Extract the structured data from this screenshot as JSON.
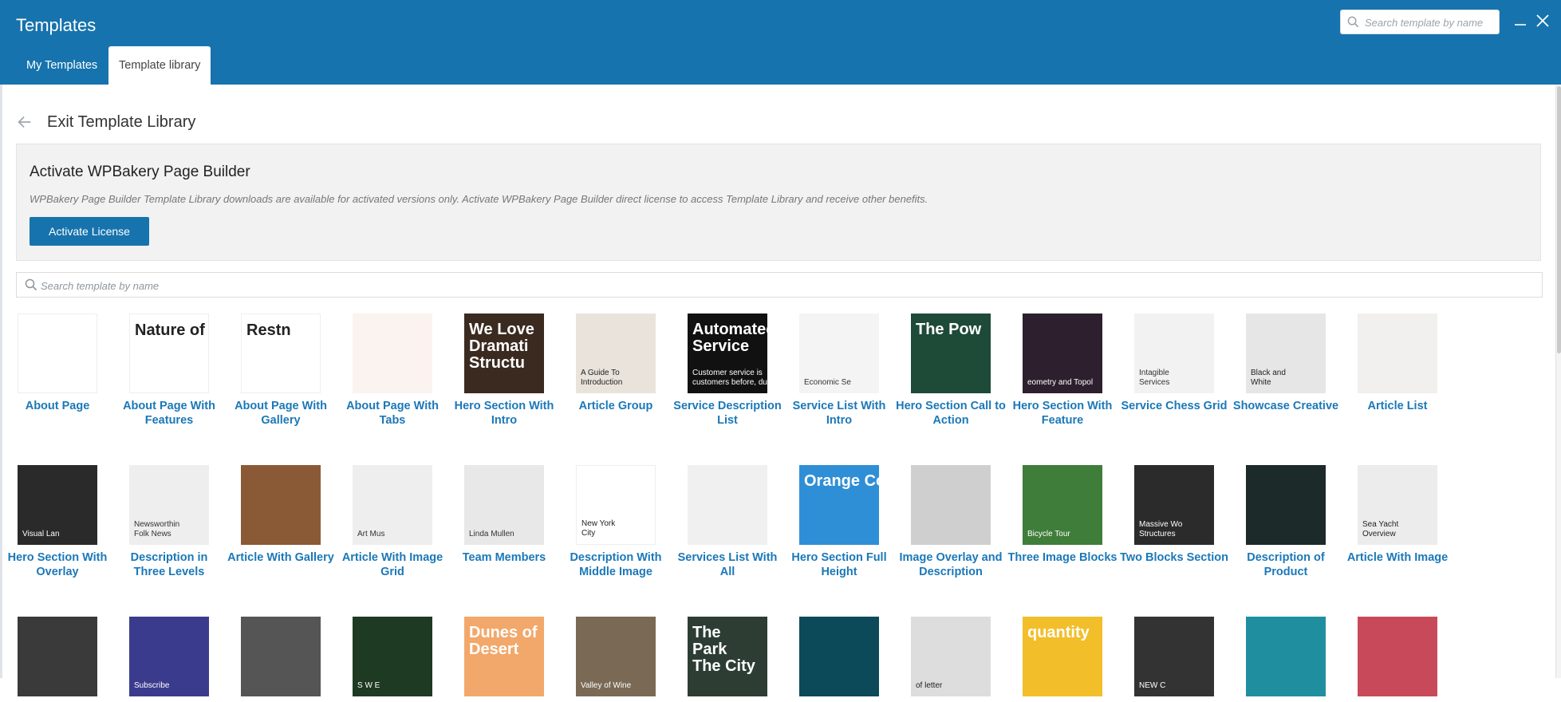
{
  "modal": {
    "title": "Templates"
  },
  "header_search": {
    "placeholder": "Search template by name"
  },
  "tabs": [
    {
      "label": "My Templates"
    },
    {
      "label": "Template library"
    }
  ],
  "back": {
    "label": "Exit Template Library"
  },
  "notice": {
    "title": "Activate WPBakery Page Builder",
    "text": "WPBakery Page Builder Template Library downloads are available for activated versions only. Activate WPBakery Page Builder direct license to access Template Library and receive other benefits.",
    "button_label": "Activate License"
  },
  "library_search": {
    "placeholder": "Search template by name"
  },
  "templates": [
    {
      "name": "About Page",
      "bg": "#ffffff",
      "fg": "#333333",
      "thumb_title": "",
      "thumb_sub": ""
    },
    {
      "name": "About Page With Features",
      "bg": "#ffffff",
      "fg": "#222222",
      "thumb_title": "Nature of De",
      "thumb_sub": ""
    },
    {
      "name": "About Page With Gallery",
      "bg": "#ffffff",
      "fg": "#222222",
      "thumb_title": "Restn",
      "thumb_sub": ""
    },
    {
      "name": "About Page With Tabs",
      "bg": "#fbf3ef",
      "fg": "#555555",
      "thumb_title": "",
      "thumb_sub": ""
    },
    {
      "name": "Hero Section With Intro",
      "bg": "#3a2a20",
      "fg": "#ffffff",
      "thumb_title": "We Love\nDramati\nStructu",
      "thumb_sub": ""
    },
    {
      "name": "Article Group",
      "bg": "#e9e3dc",
      "fg": "#222222",
      "thumb_title": "",
      "thumb_sub": "A Guide To\nIntroduction"
    },
    {
      "name": "Service Description List",
      "bg": "#111111",
      "fg": "#ffffff",
      "thumb_title": "Automated\nService",
      "thumb_sub": "Customer service is\ncustomers before, du"
    },
    {
      "name": "Service List With Intro",
      "bg": "#f4f4f4",
      "fg": "#333333",
      "thumb_title": "",
      "thumb_sub": "Economic Se"
    },
    {
      "name": "Hero Section Call to Action",
      "bg": "#1e4a38",
      "fg": "#ffffff",
      "thumb_title": "The Pow",
      "thumb_sub": ""
    },
    {
      "name": "Hero Section With Feature",
      "bg": "#2d1f2d",
      "fg": "#ffffff",
      "thumb_title": "",
      "thumb_sub": "eometry and Topol"
    },
    {
      "name": "Service Chess Grid",
      "bg": "#f2f2f2",
      "fg": "#333333",
      "thumb_title": "",
      "thumb_sub": "Intagible\nServices"
    },
    {
      "name": "Showcase Creative",
      "bg": "#e6e6e6",
      "fg": "#222222",
      "thumb_title": "",
      "thumb_sub": "Black and\nWhite"
    },
    {
      "name": "Article List",
      "bg": "#f2f0ee",
      "fg": "#555555",
      "thumb_title": "",
      "thumb_sub": ""
    },
    {
      "name": "Hero Section With Overlay",
      "bg": "#2a2a2a",
      "fg": "#ffffff",
      "thumb_title": "",
      "thumb_sub": "Visual Lan"
    },
    {
      "name": "Description in Three Levels",
      "bg": "#eeeeee",
      "fg": "#333333",
      "thumb_title": "",
      "thumb_sub": "Newsworthin\nFolk News"
    },
    {
      "name": "Article With Gallery",
      "bg": "#8a5a36",
      "fg": "#ffffff",
      "thumb_title": "",
      "thumb_sub": ""
    },
    {
      "name": "Article With Image Grid",
      "bg": "#eeeeee",
      "fg": "#333333",
      "thumb_title": "",
      "thumb_sub": "Art Mus"
    },
    {
      "name": "Team Members",
      "bg": "#e8e8e8",
      "fg": "#333333",
      "thumb_title": "",
      "thumb_sub": "Linda Mullen"
    },
    {
      "name": "Description With Middle Image",
      "bg": "#ffffff",
      "fg": "#222222",
      "thumb_title": "",
      "thumb_sub": "New York\nCity"
    },
    {
      "name": "Services List With All",
      "bg": "#f0f0f0",
      "fg": "#333333",
      "thumb_title": "",
      "thumb_sub": ""
    },
    {
      "name": "Hero Section Full Height",
      "bg": "#2f8fd6",
      "fg": "#ffffff",
      "thumb_title": "Orange Count",
      "thumb_sub": ""
    },
    {
      "name": "Image Overlay and Description",
      "bg": "#cfcfcf",
      "fg": "#222222",
      "thumb_title": "",
      "thumb_sub": ""
    },
    {
      "name": "Three Image Blocks",
      "bg": "#3f7d3a",
      "fg": "#ffffff",
      "thumb_title": "",
      "thumb_sub": "Bicycle Tour"
    },
    {
      "name": "Two Blocks Section",
      "bg": "#2b2b2b",
      "fg": "#ffffff",
      "thumb_title": "",
      "thumb_sub": "Massive Wo\nStructures"
    },
    {
      "name": "Description of Product",
      "bg": "#1d2a2a",
      "fg": "#ffffff",
      "thumb_title": "",
      "thumb_sub": ""
    },
    {
      "name": "Article With Image",
      "bg": "#ececec",
      "fg": "#222222",
      "thumb_title": "",
      "thumb_sub": "Sea Yacht\nOverview"
    },
    {
      "name": "",
      "bg": "#3a3a3a",
      "fg": "#ffffff",
      "thumb_title": "",
      "thumb_sub": ""
    },
    {
      "name": "",
      "bg": "#3b3b8e",
      "fg": "#ffffff",
      "thumb_title": "",
      "thumb_sub": "Subscribe"
    },
    {
      "name": "",
      "bg": "#555555",
      "fg": "#ffffff",
      "thumb_title": "",
      "thumb_sub": ""
    },
    {
      "name": "",
      "bg": "#1f3a22",
      "fg": "#ffffff",
      "thumb_title": "",
      "thumb_sub": "S W E"
    },
    {
      "name": "",
      "bg": "#f2a86a",
      "fg": "#ffffff",
      "thumb_title": "Dunes of\nDesert",
      "thumb_sub": ""
    },
    {
      "name": "",
      "bg": "#7a6a55",
      "fg": "#ffffff",
      "thumb_title": "",
      "thumb_sub": "Valley of Wine"
    },
    {
      "name": "",
      "bg": "#2d3d33",
      "fg": "#ffffff",
      "thumb_title": "The\nPark\nThe City",
      "thumb_sub": ""
    },
    {
      "name": "",
      "bg": "#0c4a5a",
      "fg": "#ffffff",
      "thumb_title": "",
      "thumb_sub": ""
    },
    {
      "name": "",
      "bg": "#dddddd",
      "fg": "#222222",
      "thumb_title": "",
      "thumb_sub": "of letter"
    },
    {
      "name": "",
      "bg": "#f2be2a",
      "fg": "#ffffff",
      "thumb_title": "quantity",
      "thumb_sub": ""
    },
    {
      "name": "",
      "bg": "#333333",
      "fg": "#ffffff",
      "thumb_title": "",
      "thumb_sub": "NEW C"
    },
    {
      "name": "",
      "bg": "#1f8fa0",
      "fg": "#ffffff",
      "thumb_title": "",
      "thumb_sub": ""
    },
    {
      "name": "",
      "bg": "#c84a5a",
      "fg": "#ffffff",
      "thumb_title": "",
      "thumb_sub": ""
    }
  ]
}
